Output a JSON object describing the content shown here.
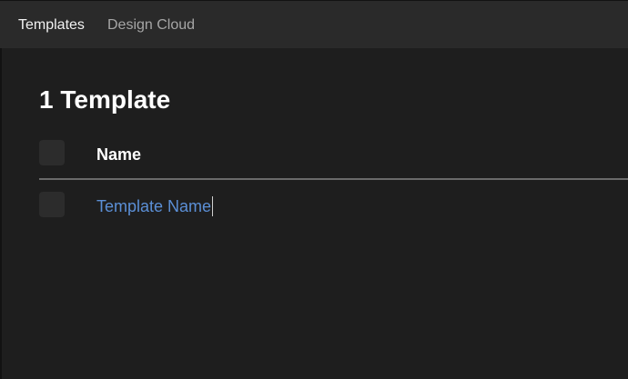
{
  "tabs": [
    {
      "label": "Templates",
      "active": true
    },
    {
      "label": "Design Cloud",
      "active": false
    }
  ],
  "heading": "1 Template",
  "table": {
    "columns": [
      "Name"
    ],
    "rows": [
      {
        "name": "Template Name"
      }
    ]
  },
  "colors": {
    "background": "#1e1e1e",
    "tabbar": "#2a2a2a",
    "link": "#5b8fd6",
    "divider": "#6a6a6a"
  }
}
